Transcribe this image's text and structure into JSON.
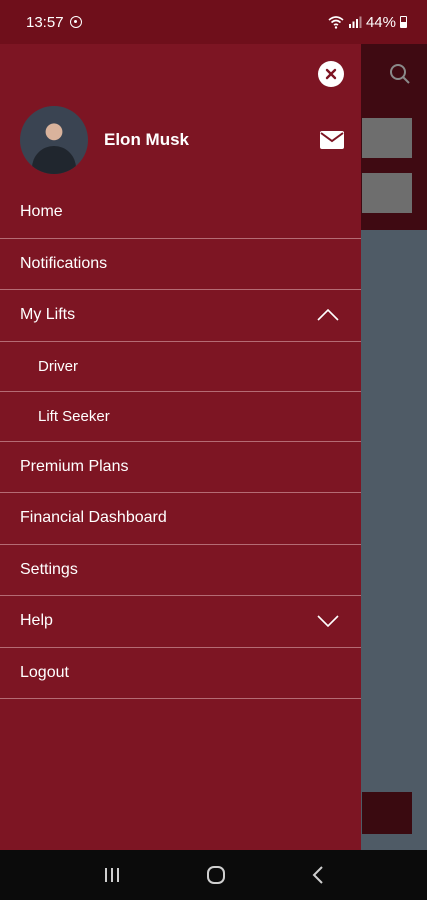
{
  "status_bar": {
    "time": "13:57",
    "battery": "44%"
  },
  "drawer": {
    "user_name": "Elon Musk",
    "menu": [
      {
        "label": "Home"
      },
      {
        "label": "Notifications"
      },
      {
        "label": "My Lifts",
        "expanded": true
      },
      {
        "label": "Driver",
        "sub": true
      },
      {
        "label": "Lift Seeker",
        "sub": true
      },
      {
        "label": "Premium Plans"
      },
      {
        "label": "Financial Dashboard"
      },
      {
        "label": "Settings"
      },
      {
        "label": "Help",
        "expanded": false
      },
      {
        "label": "Logout"
      }
    ]
  },
  "colors": {
    "drawer_bg": "#7d1523",
    "status_bar_bg": "#6f0f1b",
    "overlay_bg": "#4f5b66"
  },
  "icons": {
    "close": "close-icon",
    "mail": "mail-icon",
    "search": "search-icon",
    "chevron_up": "chevron-up-icon",
    "chevron_down": "chevron-down-icon"
  }
}
